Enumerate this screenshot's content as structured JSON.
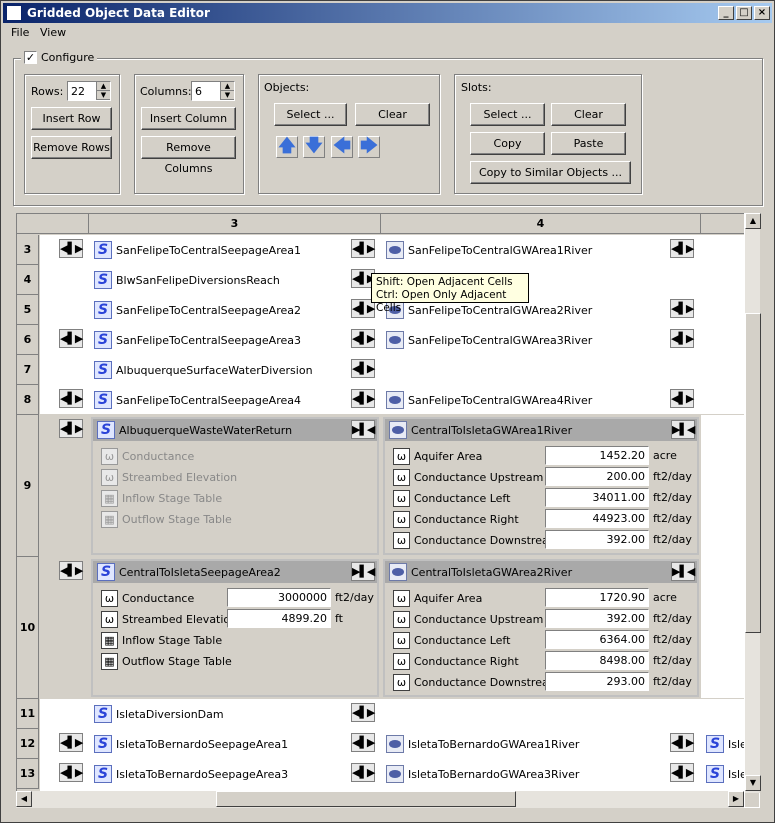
{
  "window": {
    "title": "Gridded Object Data Editor",
    "minimize": "_",
    "maximize": "□",
    "close": "×"
  },
  "menu": [
    "File",
    "View"
  ],
  "configure": {
    "label": "Configure",
    "checked": "✓"
  },
  "rows": {
    "label": "Rows:",
    "value": "22",
    "insert": "Insert Row",
    "remove": "Remove Rows"
  },
  "columns": {
    "label": "Columns:",
    "value": "6",
    "insert": "Insert Column",
    "remove": "Remove Columns"
  },
  "objects": {
    "label": "Objects:",
    "select": "Select ...",
    "clear": "Clear",
    "arrows": [
      "🡅",
      "🡇",
      "🡄",
      "🡆"
    ]
  },
  "slots": {
    "label": "Slots:",
    "select": "Select ...",
    "clear": "Clear",
    "copy": "Copy",
    "paste": "Paste",
    "copy_similar": "Copy to Similar Objects ..."
  },
  "grid": {
    "col_headers": [
      "3",
      "4"
    ],
    "row_labels": [
      "3",
      "4",
      "5",
      "6",
      "7",
      "8",
      "9",
      "10",
      "11",
      "12",
      "13"
    ],
    "cells": {
      "r3c3": "SanFelipeToCentralSeepageArea1",
      "r3c4": "SanFelipeToCentralGWArea1River",
      "r4c3": "BlwSanFelipeDiversionsReach",
      "r5c3": "SanFelipeToCentralSeepageArea2",
      "r5c4": "SanFelipeToCentralGWArea2River",
      "r6c3": "SanFelipeToCentralSeepageArea3",
      "r6c4": "SanFelipeToCentralGWArea3River",
      "r7c3": "AlbuquerqueSurfaceWaterDiversion",
      "r8c3": "SanFelipeToCentralSeepageArea4",
      "r8c4": "SanFelipeToCentralGWArea4River",
      "r11c3": "IsletaDiversionDam",
      "r12c3": "IsletaToBernardoSeepageArea1",
      "r12c4": "IsletaToBernardoGWArea1River",
      "r12c5": "Isle",
      "r13c3": "IsletaToBernardoSeepageArea3",
      "r13c4": "IsletaToBernardoGWArea3River",
      "r13c5": "Isle"
    },
    "r9c3": {
      "title": "AlbuquerqueWasteWaterReturn",
      "slots": [
        "Conductance",
        "Streambed Elevation",
        "Inflow Stage Table",
        "Outflow Stage Table"
      ]
    },
    "r9c4": {
      "title": "CentralToIsletaGWArea1River",
      "slots": [
        {
          "name": "Aquifer Area",
          "value": "1452.20",
          "unit": "acre"
        },
        {
          "name": "Conductance Upstream",
          "value": "200.00",
          "unit": "ft2/day"
        },
        {
          "name": "Conductance Left",
          "value": "34011.00",
          "unit": "ft2/day"
        },
        {
          "name": "Conductance Right",
          "value": "44923.00",
          "unit": "ft2/day"
        },
        {
          "name": "Conductance Downstream",
          "value": "392.00",
          "unit": "ft2/day"
        }
      ]
    },
    "r10c3": {
      "title": "CentralToIsletaSeepageArea2",
      "slots": [
        {
          "name": "Conductance",
          "value": "3000000",
          "unit": "ft2/day"
        },
        {
          "name": "Streambed Elevation",
          "value": "4899.20",
          "unit": "ft"
        },
        {
          "name": "Inflow Stage Table"
        },
        {
          "name": "Outflow Stage Table"
        }
      ]
    },
    "r10c4": {
      "title": "CentralToIsletaGWArea2River",
      "slots": [
        {
          "name": "Aquifer Area",
          "value": "1720.90",
          "unit": "acre"
        },
        {
          "name": "Conductance Upstream",
          "value": "392.00",
          "unit": "ft2/day"
        },
        {
          "name": "Conductance Left",
          "value": "6364.00",
          "unit": "ft2/day"
        },
        {
          "name": "Conductance Right",
          "value": "8498.00",
          "unit": "ft2/day"
        },
        {
          "name": "Conductance Downstream",
          "value": "293.00",
          "unit": "ft2/day"
        }
      ]
    }
  },
  "tooltip": {
    "line1": "Shift: Open Adjacent Cells",
    "line2": "Ctrl: Open Only Adjacent Cells"
  },
  "icons": {
    "object": "S",
    "expand": "◀▌▶",
    "collapse": "▶▌◀",
    "slot": "ω",
    "table": "▦"
  }
}
